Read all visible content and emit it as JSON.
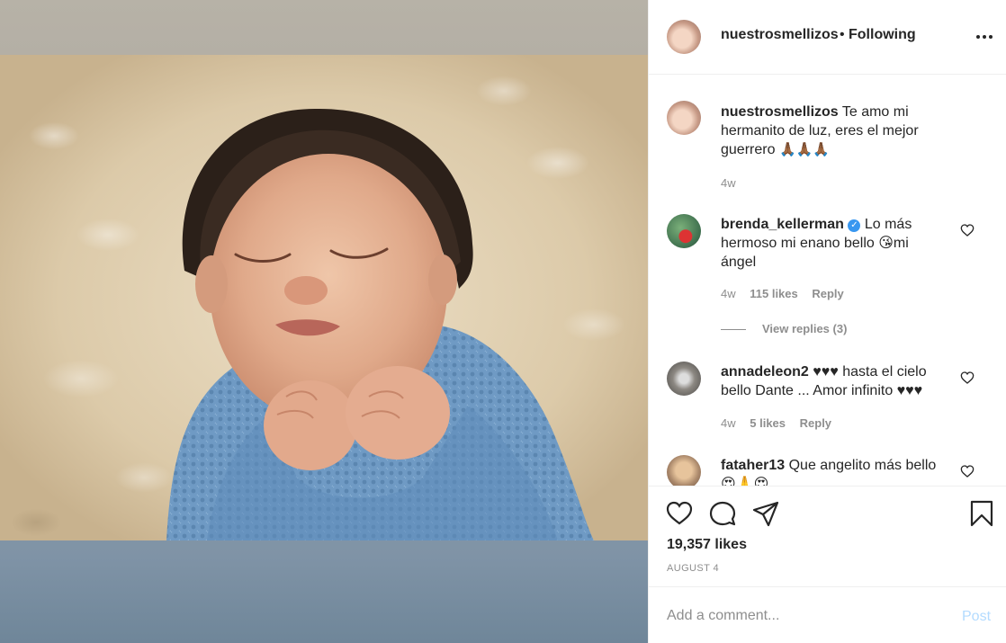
{
  "post": {
    "username": "nuestrosmellizos",
    "dot": "•",
    "follow_status": "Following",
    "caption": {
      "username": "nuestrosmellizos",
      "text": "Te amo mi hermanito de luz, eres el mejor guerrero",
      "emoji": "🙏🏾🙏🏾🙏🏾",
      "time": "4w"
    },
    "likes": "19,357 likes",
    "date": "AUGUST 4"
  },
  "comments": [
    {
      "username": "brenda_kellerman",
      "verified": true,
      "verified_glyph": "✓",
      "text_before": "Lo más hermoso mi enano bello ",
      "emoji": "😘",
      "text_after": "mi ángel",
      "time": "4w",
      "likes": "115 likes",
      "reply": "Reply",
      "view_replies": "View replies (3)"
    },
    {
      "username": "annadeleon2",
      "text": "♥♥♥ hasta el cielo bello Dante ... Amor infinito ♥♥♥",
      "time": "4w",
      "likes": "5 likes",
      "reply": "Reply"
    },
    {
      "username": "fataher13",
      "text": "Que angelito más bello",
      "emoji": "😍🙏😍"
    }
  ],
  "add_comment": {
    "placeholder": "Add a comment...",
    "post_label": "Post"
  },
  "icons": {
    "more": "more-options-icon",
    "like": "heart-icon",
    "comment": "comment-icon",
    "share": "share-icon",
    "save": "bookmark-icon"
  },
  "colors": {
    "text": "#262626",
    "muted": "#8e8e8e",
    "link_disabled": "#b3dbff",
    "verified": "#3897f0",
    "blanket": "#6f9ac4"
  }
}
